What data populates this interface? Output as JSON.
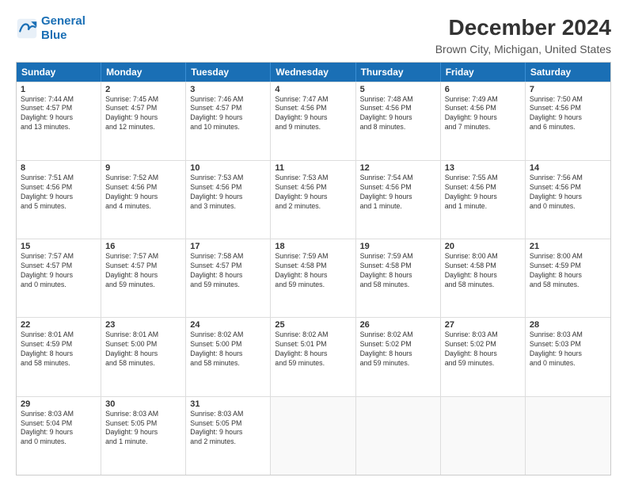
{
  "logo": {
    "line1": "General",
    "line2": "Blue"
  },
  "title": "December 2024",
  "subtitle": "Brown City, Michigan, United States",
  "header_days": [
    "Sunday",
    "Monday",
    "Tuesday",
    "Wednesday",
    "Thursday",
    "Friday",
    "Saturday"
  ],
  "rows": [
    [
      {
        "day": "1",
        "lines": [
          "Sunrise: 7:44 AM",
          "Sunset: 4:57 PM",
          "Daylight: 9 hours",
          "and 13 minutes."
        ]
      },
      {
        "day": "2",
        "lines": [
          "Sunrise: 7:45 AM",
          "Sunset: 4:57 PM",
          "Daylight: 9 hours",
          "and 12 minutes."
        ]
      },
      {
        "day": "3",
        "lines": [
          "Sunrise: 7:46 AM",
          "Sunset: 4:57 PM",
          "Daylight: 9 hours",
          "and 10 minutes."
        ]
      },
      {
        "day": "4",
        "lines": [
          "Sunrise: 7:47 AM",
          "Sunset: 4:56 PM",
          "Daylight: 9 hours",
          "and 9 minutes."
        ]
      },
      {
        "day": "5",
        "lines": [
          "Sunrise: 7:48 AM",
          "Sunset: 4:56 PM",
          "Daylight: 9 hours",
          "and 8 minutes."
        ]
      },
      {
        "day": "6",
        "lines": [
          "Sunrise: 7:49 AM",
          "Sunset: 4:56 PM",
          "Daylight: 9 hours",
          "and 7 minutes."
        ]
      },
      {
        "day": "7",
        "lines": [
          "Sunrise: 7:50 AM",
          "Sunset: 4:56 PM",
          "Daylight: 9 hours",
          "and 6 minutes."
        ]
      }
    ],
    [
      {
        "day": "8",
        "lines": [
          "Sunrise: 7:51 AM",
          "Sunset: 4:56 PM",
          "Daylight: 9 hours",
          "and 5 minutes."
        ]
      },
      {
        "day": "9",
        "lines": [
          "Sunrise: 7:52 AM",
          "Sunset: 4:56 PM",
          "Daylight: 9 hours",
          "and 4 minutes."
        ]
      },
      {
        "day": "10",
        "lines": [
          "Sunrise: 7:53 AM",
          "Sunset: 4:56 PM",
          "Daylight: 9 hours",
          "and 3 minutes."
        ]
      },
      {
        "day": "11",
        "lines": [
          "Sunrise: 7:53 AM",
          "Sunset: 4:56 PM",
          "Daylight: 9 hours",
          "and 2 minutes."
        ]
      },
      {
        "day": "12",
        "lines": [
          "Sunrise: 7:54 AM",
          "Sunset: 4:56 PM",
          "Daylight: 9 hours",
          "and 1 minute."
        ]
      },
      {
        "day": "13",
        "lines": [
          "Sunrise: 7:55 AM",
          "Sunset: 4:56 PM",
          "Daylight: 9 hours",
          "and 1 minute."
        ]
      },
      {
        "day": "14",
        "lines": [
          "Sunrise: 7:56 AM",
          "Sunset: 4:56 PM",
          "Daylight: 9 hours",
          "and 0 minutes."
        ]
      }
    ],
    [
      {
        "day": "15",
        "lines": [
          "Sunrise: 7:57 AM",
          "Sunset: 4:57 PM",
          "Daylight: 9 hours",
          "and 0 minutes."
        ]
      },
      {
        "day": "16",
        "lines": [
          "Sunrise: 7:57 AM",
          "Sunset: 4:57 PM",
          "Daylight: 8 hours",
          "and 59 minutes."
        ]
      },
      {
        "day": "17",
        "lines": [
          "Sunrise: 7:58 AM",
          "Sunset: 4:57 PM",
          "Daylight: 8 hours",
          "and 59 minutes."
        ]
      },
      {
        "day": "18",
        "lines": [
          "Sunrise: 7:59 AM",
          "Sunset: 4:58 PM",
          "Daylight: 8 hours",
          "and 59 minutes."
        ]
      },
      {
        "day": "19",
        "lines": [
          "Sunrise: 7:59 AM",
          "Sunset: 4:58 PM",
          "Daylight: 8 hours",
          "and 58 minutes."
        ]
      },
      {
        "day": "20",
        "lines": [
          "Sunrise: 8:00 AM",
          "Sunset: 4:58 PM",
          "Daylight: 8 hours",
          "and 58 minutes."
        ]
      },
      {
        "day": "21",
        "lines": [
          "Sunrise: 8:00 AM",
          "Sunset: 4:59 PM",
          "Daylight: 8 hours",
          "and 58 minutes."
        ]
      }
    ],
    [
      {
        "day": "22",
        "lines": [
          "Sunrise: 8:01 AM",
          "Sunset: 4:59 PM",
          "Daylight: 8 hours",
          "and 58 minutes."
        ]
      },
      {
        "day": "23",
        "lines": [
          "Sunrise: 8:01 AM",
          "Sunset: 5:00 PM",
          "Daylight: 8 hours",
          "and 58 minutes."
        ]
      },
      {
        "day": "24",
        "lines": [
          "Sunrise: 8:02 AM",
          "Sunset: 5:00 PM",
          "Daylight: 8 hours",
          "and 58 minutes."
        ]
      },
      {
        "day": "25",
        "lines": [
          "Sunrise: 8:02 AM",
          "Sunset: 5:01 PM",
          "Daylight: 8 hours",
          "and 59 minutes."
        ]
      },
      {
        "day": "26",
        "lines": [
          "Sunrise: 8:02 AM",
          "Sunset: 5:02 PM",
          "Daylight: 8 hours",
          "and 59 minutes."
        ]
      },
      {
        "day": "27",
        "lines": [
          "Sunrise: 8:03 AM",
          "Sunset: 5:02 PM",
          "Daylight: 8 hours",
          "and 59 minutes."
        ]
      },
      {
        "day": "28",
        "lines": [
          "Sunrise: 8:03 AM",
          "Sunset: 5:03 PM",
          "Daylight: 9 hours",
          "and 0 minutes."
        ]
      }
    ],
    [
      {
        "day": "29",
        "lines": [
          "Sunrise: 8:03 AM",
          "Sunset: 5:04 PM",
          "Daylight: 9 hours",
          "and 0 minutes."
        ]
      },
      {
        "day": "30",
        "lines": [
          "Sunrise: 8:03 AM",
          "Sunset: 5:05 PM",
          "Daylight: 9 hours",
          "and 1 minute."
        ]
      },
      {
        "day": "31",
        "lines": [
          "Sunrise: 8:03 AM",
          "Sunset: 5:05 PM",
          "Daylight: 9 hours",
          "and 2 minutes."
        ]
      },
      {
        "day": "",
        "lines": []
      },
      {
        "day": "",
        "lines": []
      },
      {
        "day": "",
        "lines": []
      },
      {
        "day": "",
        "lines": []
      }
    ]
  ]
}
